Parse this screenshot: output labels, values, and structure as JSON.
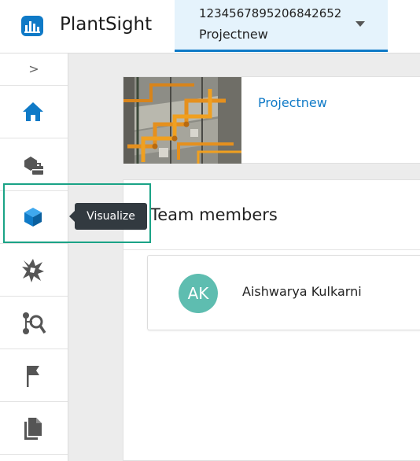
{
  "app": {
    "title": "PlantSight"
  },
  "project_selector": {
    "id": "1234567895206842652",
    "name": "Projectnew"
  },
  "sidebar": {
    "expand_glyph": ">",
    "items": [
      {
        "name": "home-icon"
      },
      {
        "name": "assets-icon"
      },
      {
        "name": "visualize-icon",
        "tooltip": "Visualize"
      },
      {
        "name": "issues-icon"
      },
      {
        "name": "search-graph-icon"
      },
      {
        "name": "flag-icon"
      },
      {
        "name": "documents-icon"
      }
    ]
  },
  "project_card": {
    "link_label": "Projectnew"
  },
  "team": {
    "title": "Team members",
    "members": [
      {
        "initials": "AK",
        "name": "Aishwarya Kulkarni"
      }
    ]
  },
  "colors": {
    "accent": "#0f7ac7",
    "focus": "#1aa386",
    "avatar": "#5ebdb0",
    "tooltip": "#323a40"
  }
}
